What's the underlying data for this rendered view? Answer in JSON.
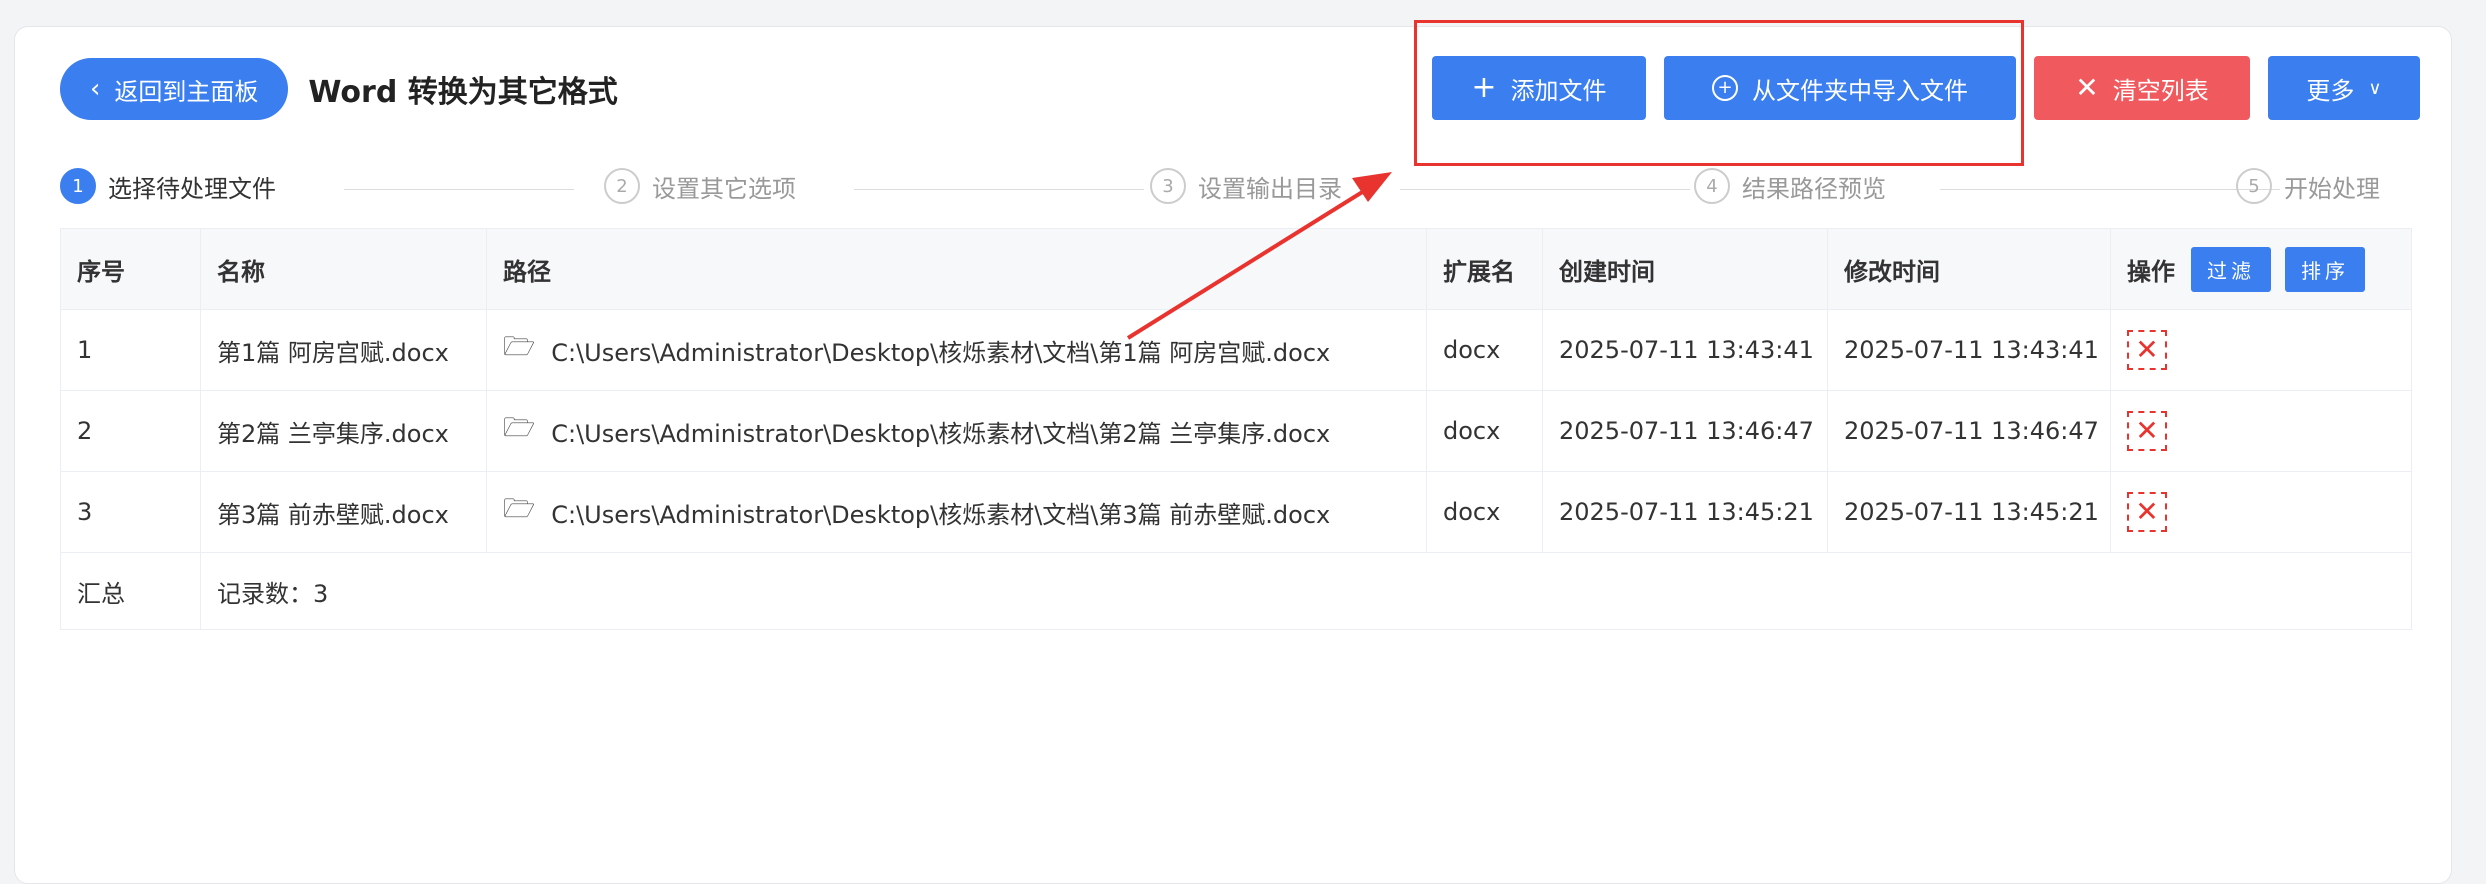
{
  "header": {
    "back_label": "返回到主面板",
    "title": "Word 转换为其它格式"
  },
  "toolbar": {
    "add_file": "添加文件",
    "import_folder": "从文件夹中导入文件",
    "clear_list": "清空列表",
    "more": "更多"
  },
  "steps": [
    {
      "num": "1",
      "label": "选择待处理文件"
    },
    {
      "num": "2",
      "label": "设置其它选项"
    },
    {
      "num": "3",
      "label": "设置输出目录"
    },
    {
      "num": "4",
      "label": "结果路径预览"
    },
    {
      "num": "5",
      "label": "开始处理"
    }
  ],
  "table": {
    "columns": [
      "序号",
      "名称",
      "路径",
      "扩展名",
      "创建时间",
      "修改时间",
      "操作"
    ],
    "filter_label": "过滤",
    "sort_label": "排序",
    "rows": [
      {
        "index": "1",
        "name": "第1篇 阿房宫赋.docx",
        "path": "C:\\Users\\Administrator\\Desktop\\核烁素材\\文档\\第1篇 阿房宫赋.docx",
        "ext": "docx",
        "created": "2025-07-11 13:43:41",
        "modified": "2025-07-11 13:43:41"
      },
      {
        "index": "2",
        "name": "第2篇 兰亭集序.docx",
        "path": "C:\\Users\\Administrator\\Desktop\\核烁素材\\文档\\第2篇 兰亭集序.docx",
        "ext": "docx",
        "created": "2025-07-11 13:46:47",
        "modified": "2025-07-11 13:46:47"
      },
      {
        "index": "3",
        "name": "第3篇 前赤壁赋.docx",
        "path": "C:\\Users\\Administrator\\Desktop\\核烁素材\\文档\\第3篇 前赤壁赋.docx",
        "ext": "docx",
        "created": "2025-07-11 13:45:21",
        "modified": "2025-07-11 13:45:21"
      }
    ],
    "summary_label": "汇总",
    "summary_value": "记录数：3"
  },
  "colors": {
    "primary": "#3a7ef0",
    "danger": "#f0595e",
    "annotation": "#e8332f"
  },
  "icons": {
    "back": "chevron-left-icon",
    "add": "plus-icon",
    "import": "circle-plus-icon",
    "clear": "close-icon",
    "more": "chevron-down-icon",
    "folder": "folder-icon",
    "delete": "delete-x-icon"
  }
}
